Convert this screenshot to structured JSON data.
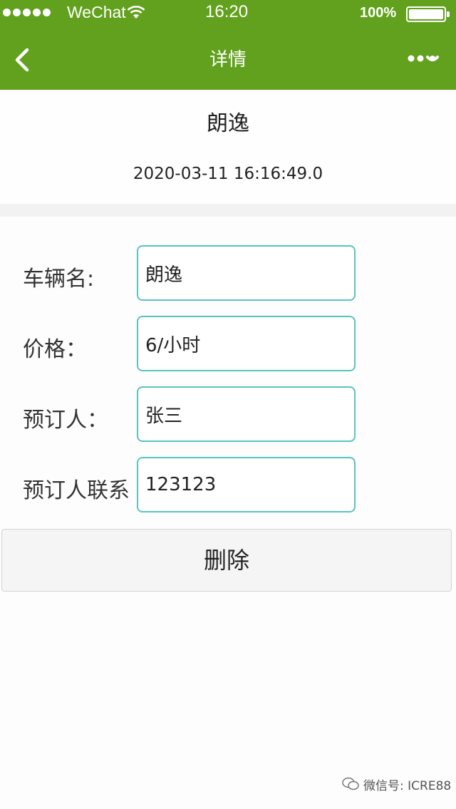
{
  "status_bar": {
    "carrier": "WeChat",
    "time": "16:20",
    "battery": "100%"
  },
  "nav": {
    "title": "详情",
    "back_icon": "chevron-left-icon",
    "more_icon": "more-dots-icon"
  },
  "detail": {
    "vehicle_name": "朗逸",
    "timestamp": "2020-03-11 16:16:49.0"
  },
  "form": {
    "fields": [
      {
        "label": "车辆名:",
        "value": "朗逸"
      },
      {
        "label": "价格：",
        "value": "6/小时"
      },
      {
        "label": "预订人：",
        "value": "张三"
      },
      {
        "label": "预订人联系",
        "value": "123123"
      }
    ]
  },
  "actions": {
    "delete_label": "删除"
  },
  "watermark": {
    "text": "微信号: ICRE88"
  },
  "colors": {
    "nav_bg": "#62a11d",
    "input_border": "#58c4bd",
    "button_bg": "#f5f5f5"
  }
}
